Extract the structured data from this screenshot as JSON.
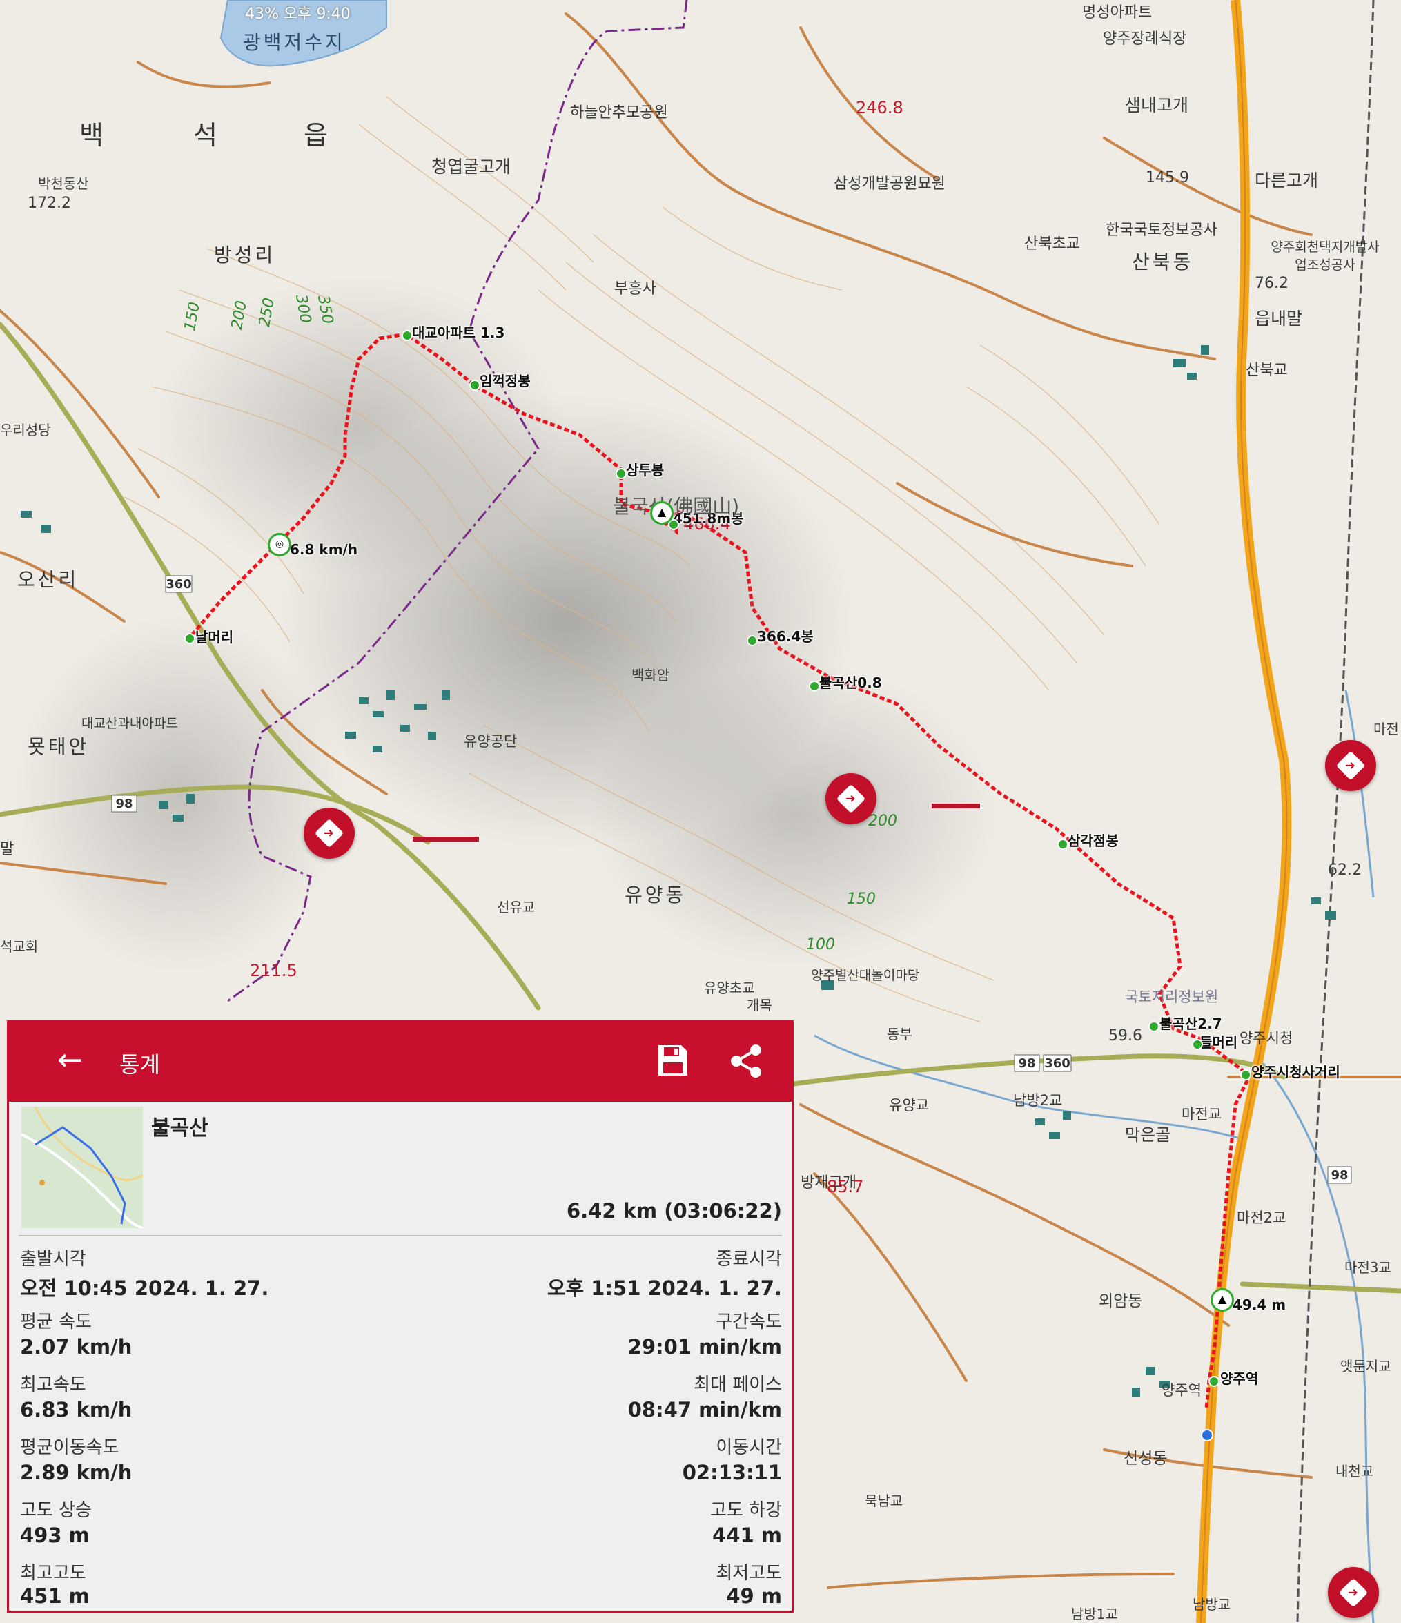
{
  "status_bar": {
    "text": "43% 오후 9:40"
  },
  "map": {
    "area_labels": [
      "광백저수지",
      "백",
      "석",
      "읍",
      "방성리",
      "오산리",
      "묫태안",
      "유양동",
      "산북동",
      "하늘안추모공원",
      "청엽굴고개",
      "삼성개발공원묘원",
      "한국국토정보공사",
      "산북초교",
      "부흥사",
      "샘내고개",
      "다른고개",
      "양주장례식장",
      "명성아파트",
      "양주회천택지개발사업조성공사",
      "읍내말",
      "산북교",
      "박천동산",
      "우리성당",
      "대교산과내아파트",
      "백화암",
      "유양공단",
      "선유교",
      "유양초교",
      "양주별산대놀이마당",
      "남방2교",
      "마전교",
      "막은골",
      "마전2교",
      "마전3교",
      "외암동",
      "양주역",
      "신성동",
      "내천교",
      "앳둔지교",
      "묵남교",
      "남방교",
      "남방1교",
      "유양교",
      "마전",
      "석교회",
      "말",
      "국토지리정보원",
      "개목",
      "동부",
      "방재고개",
      "양주시청"
    ],
    "elevations": [
      "172.2",
      "246.8",
      "145.9",
      "76.2",
      "62.2",
      "211.5",
      "85.7",
      "59.6",
      "466.4"
    ],
    "contours": [
      "150",
      "200",
      "250",
      "300",
      "350",
      "200",
      "150",
      "100"
    ],
    "road_numbers": [
      "360",
      "98",
      "98",
      "360",
      "98"
    ],
    "waypoints": [
      "대교아파트 1.3",
      "임꺽정봉",
      "상투봉",
      "451.8m봉",
      "366.4봉",
      "불곡산0.8",
      "삼각점봉",
      "불곡산2.7",
      "들머리",
      "양주시청사거리",
      "양주역",
      "날머리",
      "6.8 km/h",
      "49.4 m",
      "불국산(佛國山)"
    ]
  },
  "panel": {
    "header_title": "통계",
    "track_name": "불곡산",
    "distance_time": "6.42 km (03:06:22)",
    "stats": [
      {
        "left_label": "출발시각",
        "left_value": "오전 10:45 2024. 1. 27.",
        "right_label": "종료시각",
        "right_value": "오후 1:51 2024. 1. 27."
      },
      {
        "left_label": "평균 속도",
        "left_value": "2.07 km/h",
        "right_label": "구간속도",
        "right_value": "29:01 min/km"
      },
      {
        "left_label": "최고속도",
        "left_value": "6.83 km/h",
        "right_label": "최대 페이스",
        "right_value": "08:47 min/km"
      },
      {
        "left_label": "평균이동속도",
        "left_value": "2.89 km/h",
        "right_label": "이동시간",
        "right_value": "02:13:11"
      },
      {
        "left_label": "고도 상승",
        "left_value": "493 m",
        "right_label": "고도 하강",
        "right_value": "441 m"
      },
      {
        "left_label": "최고고도",
        "left_value": "451 m",
        "right_label": "최저고도",
        "right_value": "49 m"
      }
    ]
  },
  "colors": {
    "accent": "#c8102e",
    "route": "#e8141e",
    "highway": "#f2a51b",
    "road": "#c8864a",
    "boundary": "#7a2a8a"
  },
  "icons": [
    "arrow-left-icon",
    "save-icon",
    "share-icon",
    "navigate-icon",
    "summit-icon",
    "speed-icon"
  ]
}
